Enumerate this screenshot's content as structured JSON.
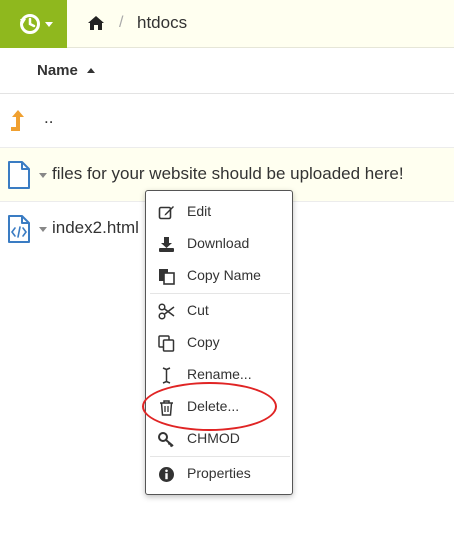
{
  "toolbar": {
    "history_icon": "history-icon",
    "home_icon": "home-icon",
    "breadcrumb_separator": "/",
    "current_folder": "htdocs"
  },
  "list_header": {
    "name_label": "Name",
    "sort_direction": "ascending"
  },
  "files": [
    {
      "name": "..",
      "icon": "level-up-icon"
    },
    {
      "name": "files for your website should be uploaded here!",
      "icon": "file-icon"
    },
    {
      "name": "index2.html",
      "icon": "code-file-icon"
    }
  ],
  "context_menu": {
    "items": [
      {
        "label": "Edit",
        "icon": "edit-icon"
      },
      {
        "label": "Download",
        "icon": "download-icon"
      },
      {
        "label": "Copy Name",
        "icon": "copy-name-icon"
      },
      {
        "label": "Cut",
        "icon": "scissors-icon"
      },
      {
        "label": "Copy",
        "icon": "copy-icon"
      },
      {
        "label": "Rename...",
        "icon": "text-cursor-icon"
      },
      {
        "label": "Delete...",
        "icon": "trash-icon"
      },
      {
        "label": "CHMOD",
        "icon": "key-icon"
      },
      {
        "label": "Properties",
        "icon": "info-icon"
      }
    ]
  },
  "colors": {
    "accent_green": "#8fb81e",
    "toolbar_bg": "#fffff0",
    "annotation_red": "#e02424",
    "file_icon_blue": "#3a7cc3",
    "parent_icon_orange": "#f0a030"
  }
}
